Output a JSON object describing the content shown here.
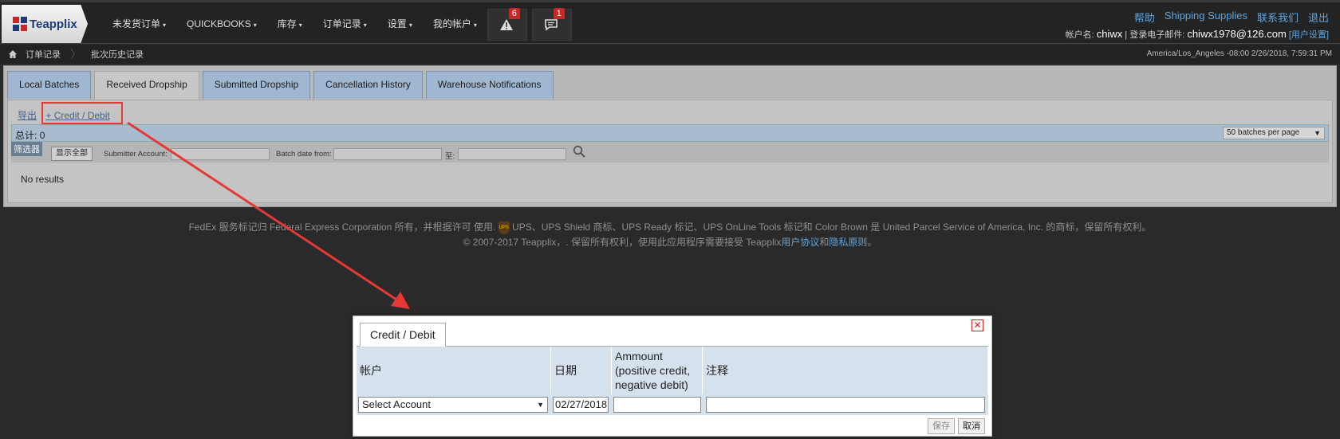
{
  "brand": {
    "name": "Teapplix"
  },
  "nav": [
    {
      "label": "未发货订单",
      "caret": "▾"
    },
    {
      "label": "QUICKBOOKS",
      "caret": "▾"
    },
    {
      "label": "库存",
      "caret": "▾"
    },
    {
      "label": "订单记录",
      "caret": "▾"
    },
    {
      "label": "设置",
      "caret": "▾"
    },
    {
      "label": "我的帐户",
      "caret": "▾"
    }
  ],
  "alerts": {
    "warning_count": "6",
    "message_count": "1"
  },
  "top_links": [
    "帮助",
    "Shipping Supplies",
    "联系我们",
    "退出"
  ],
  "user": {
    "account_label": "帐户名:",
    "account": "chiwx",
    "email_label": "登录电子邮件:",
    "email": "chiwx1978@126.com",
    "settings": "[用户设置]"
  },
  "breadcrumb": [
    "订单记录",
    "批次历史记录"
  ],
  "timestamp": "America/Los_Angeles -08:00 2/26/2018, 7:59:31 PM",
  "tabs": [
    "Local Batches",
    "Received Dropship",
    "Submitted Dropship",
    "Cancellation History",
    "Warehouse Notifications"
  ],
  "actions": {
    "export": "导出",
    "credit_debit": "+ Credit / Debit"
  },
  "totals": {
    "label": "总计:",
    "value": "0",
    "per_page": "50 batches per page"
  },
  "filters": {
    "tag": "筛选器",
    "show_all": "显示全部",
    "submitter_account": "Submitter Account:",
    "batch_date_from": "Batch date from:",
    "to": "至:"
  },
  "no_results": "No results",
  "footer": {
    "line1_a": "FedEx 服务标记归 Federal Express Corporation 所有，并根据许可 使用.",
    "ups_logo": "UPS",
    "line1_b": "UPS、UPS Shield 商标、UPS Ready 标记、UPS OnLine Tools 标记和 Color Brown 是 United Parcel Service of America, Inc. 的商标，保留所有权利。",
    "line2_a": "© 2007-2017 Teapplix，. 保留所有权利，使用此应用程序需要接受 Teapplix",
    "terms": "用户协议",
    "and": "和",
    "privacy": "隐私原则",
    "end": "。"
  },
  "dialog": {
    "tab": "Credit / Debit",
    "close": "✕",
    "columns": [
      "帐户",
      "日期",
      "Ammount\n(positive credit,\nnegative debit)",
      "注释"
    ],
    "account_select": "Select Account",
    "date_value": "02/27/2018",
    "save": "保存",
    "cancel": "取消"
  }
}
